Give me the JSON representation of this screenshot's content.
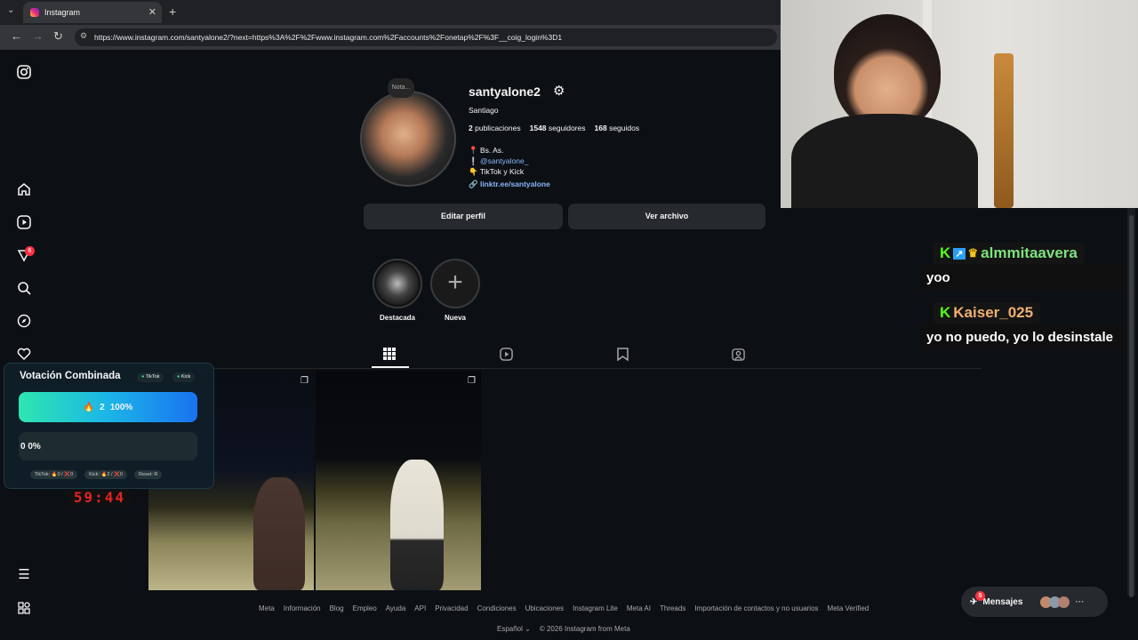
{
  "browser": {
    "tab_title": "Instagram",
    "url": "https://www.instagram.com/santyalone2/?next=https%3A%2F%2Fwww.instagram.com%2Faccounts%2Fonetap%2F%3F__coig_login%3D1"
  },
  "sidebar": {
    "notification_count": "6"
  },
  "profile": {
    "note_label": "Nota...",
    "username": "santyalone2",
    "full_name": "Santiago",
    "posts_count": "2",
    "posts_label": "publicaciones",
    "followers_count": "1548",
    "followers_label": "seguidores",
    "following_count": "168",
    "following_label": "seguidos",
    "bio": {
      "line1": "Bs. As.",
      "line2": "@santyalone_",
      "line3": "TikTok y Kick",
      "link": "linktr.ee/santyalone"
    },
    "edit_button": "Editar perfil",
    "archive_button": "Ver archivo"
  },
  "highlights": [
    {
      "label": "Destacada"
    },
    {
      "label": "Nueva"
    }
  ],
  "footer": {
    "links": [
      "Meta",
      "Información",
      "Blog",
      "Empleo",
      "Ayuda",
      "API",
      "Privacidad",
      "Condiciones",
      "Ubicaciones",
      "Instagram Lite",
      "Meta AI",
      "Threads",
      "Importación de contactos y no usuarios",
      "Meta Verified"
    ],
    "language": "Español",
    "copyright": "© 2026 Instagram from Meta"
  },
  "chat": [
    {
      "user": "almmitaavera",
      "message": "yoo"
    },
    {
      "user": "Kaiser_025",
      "message": "yo no puedo, yo lo desinstale"
    }
  ],
  "vote": {
    "title": "Votación Combinada",
    "tag_tiktok": "TikTok",
    "tag_kick": "Kick",
    "option1_count": "2",
    "option1_pct": "100%",
    "option1_share": 1.0,
    "option2_count": "0",
    "option2_pct": "0%",
    "option2_share": 0.0,
    "foot_tiktok": "TikTok: 🔥0 / ❌0",
    "foot_kick": "Kick: 🔥2 / ❌0",
    "foot_reset": "Reset: R",
    "timer": "59:44"
  },
  "messages": {
    "label": "Mensajes",
    "badge": "5"
  },
  "colors": {
    "background": "#0c1014",
    "accent_link": "#8ab4f8",
    "chat_name": "#7ee27e",
    "timer": "#e52222"
  }
}
